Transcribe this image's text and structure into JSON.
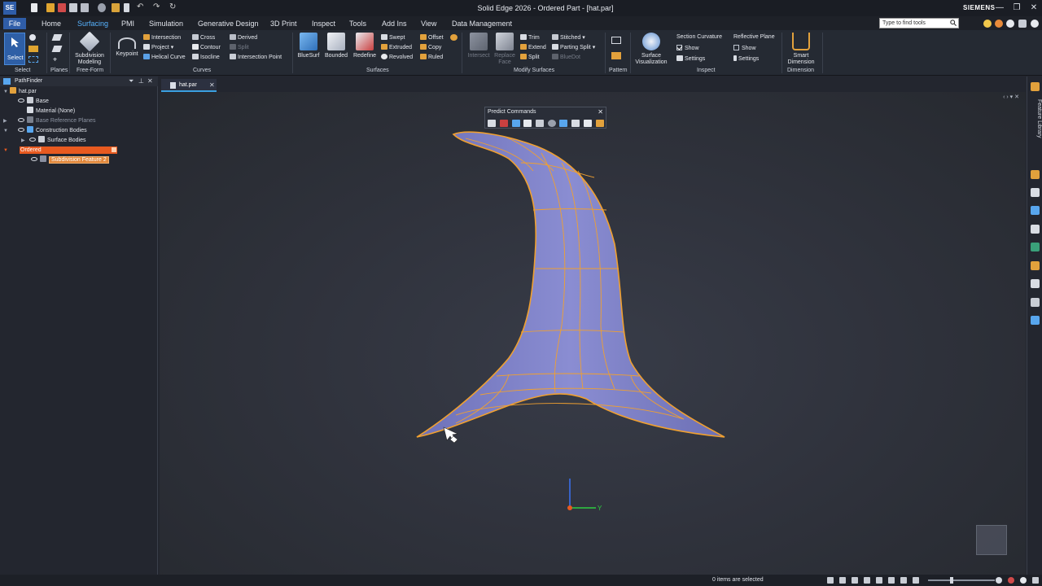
{
  "app": {
    "window_title": "Solid Edge 2026 - Ordered Part - [hat.par]",
    "logo": "SE",
    "brand": "SIEMENS",
    "window_controls": [
      "—",
      "❐",
      "✕"
    ]
  },
  "menu": {
    "file": "File",
    "tabs": [
      "Home",
      "Surfacing",
      "PMI",
      "Simulation",
      "Generative Design",
      "3D Print",
      "Inspect",
      "Tools",
      "Add Ins",
      "View",
      "Data Management"
    ],
    "active_tab": "Surfacing",
    "search_placeholder": "Type to find tools"
  },
  "ribbon": {
    "groups": {
      "select": "Select",
      "planes": "Planes",
      "freeform": "Free-Form",
      "curves": "Curves",
      "surfaces": "Surfaces",
      "modify": "Modify Surfaces",
      "pattern": "Pattern",
      "inspect": "Inspect",
      "dimension": "Dimension"
    },
    "select_label": "Select",
    "subdivision": "Subdivision Modeling",
    "keypoint": "Keypoint",
    "curves": {
      "intersection": "Intersection",
      "project": "Project",
      "helical": "Helical Curve",
      "cross": "Cross",
      "contour": "Contour",
      "isocline": "Isocline",
      "derived": "Derived",
      "split": "Split",
      "intersection_point": "Intersection Point"
    },
    "surfaces": {
      "bluesurf": "BlueSurf",
      "bounded": "Bounded",
      "redefine": "Redefine",
      "swept": "Swept",
      "extruded": "Extruded",
      "revolved": "Revolved",
      "offset": "Offset",
      "copy": "Copy",
      "ruled": "Ruled"
    },
    "modify": {
      "intersect": "Intersect",
      "replace_face": "Replace Face",
      "trim": "Trim",
      "extend": "Extend",
      "split": "Split",
      "stitched": "Stitched",
      "parting_split": "Parting Split",
      "bluedot": "BlueDot"
    },
    "surface_vis": "Surface Visualization",
    "section_curvature": "Section Curvature",
    "show": "Show",
    "settings": "Settings",
    "reflective_plane": "Reflective Plane",
    "show2": "Show",
    "settings2": "Settings",
    "smart_dimension": "Smart Dimension"
  },
  "pathfinder": {
    "title": "PathFinder",
    "items": [
      {
        "label": "hat.par"
      },
      {
        "label": "Base"
      },
      {
        "label": "Material (None)"
      },
      {
        "label": "Base Reference Planes"
      },
      {
        "label": "Construction Bodies"
      },
      {
        "label": "Surface Bodies"
      },
      {
        "label": "Ordered"
      },
      {
        "label": "Subdivision Feature 2"
      }
    ]
  },
  "document": {
    "tab_label": "hat.par",
    "close": "✕"
  },
  "predict": {
    "title": "Predict Commands",
    "close": "✕"
  },
  "triad": {
    "y_label": "Y"
  },
  "right_panel": {
    "feature_library": "Feature Library"
  },
  "status": {
    "selection": "0 items are selected"
  },
  "colors": {
    "accent": "#3aa0e0",
    "active_tab": "#57b3ff",
    "surface_fill": "#7c7fc6",
    "edge_highlight": "#f0a030",
    "ordered_highlight": "#e85a20"
  }
}
